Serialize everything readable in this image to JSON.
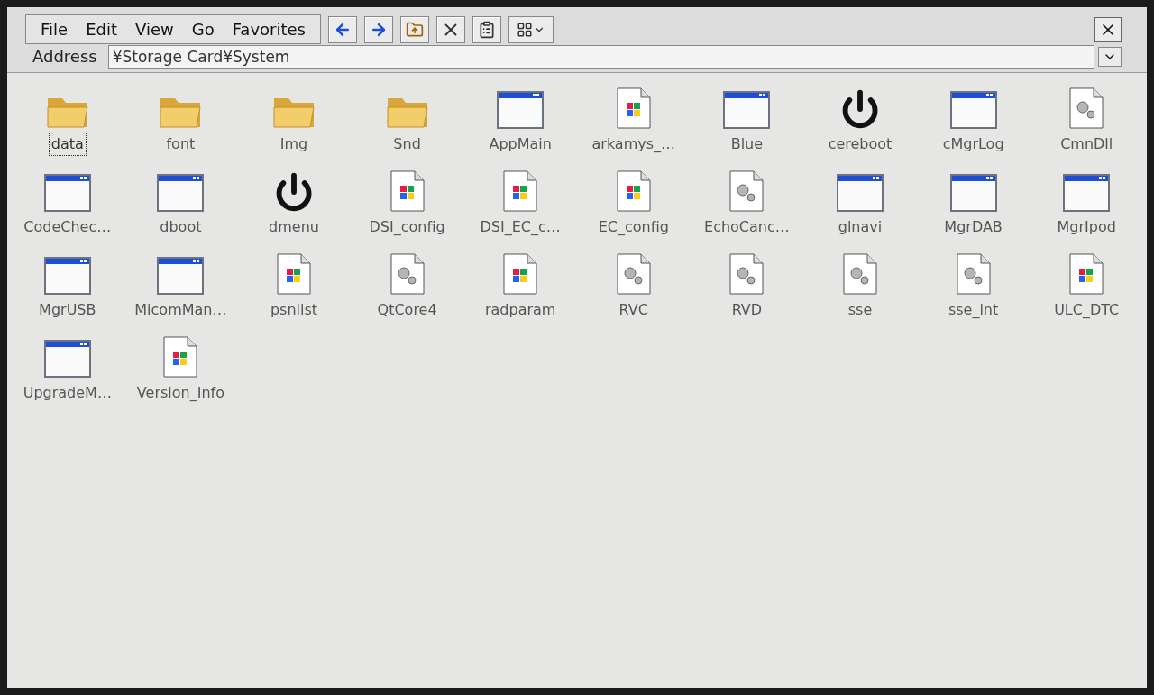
{
  "menu": [
    "File",
    "Edit",
    "View",
    "Go",
    "Favorites"
  ],
  "address": {
    "label": "Address",
    "value": "¥Storage Card¥System"
  },
  "files": [
    {
      "name": "data",
      "kind": "folder",
      "selected": true
    },
    {
      "name": "font",
      "kind": "folder",
      "selected": false
    },
    {
      "name": "Img",
      "kind": "folder",
      "selected": false
    },
    {
      "name": "Snd",
      "kind": "folder",
      "selected": false
    },
    {
      "name": "AppMain",
      "kind": "window",
      "selected": false
    },
    {
      "name": "arkamys_…",
      "kind": "document",
      "selected": false
    },
    {
      "name": "Blue",
      "kind": "window",
      "selected": false
    },
    {
      "name": "cereboot",
      "kind": "power",
      "selected": false
    },
    {
      "name": "cMgrLog",
      "kind": "window",
      "selected": false
    },
    {
      "name": "CmnDll",
      "kind": "settings",
      "selected": false
    },
    {
      "name": "CodeChec…",
      "kind": "window",
      "selected": false
    },
    {
      "name": "dboot",
      "kind": "window",
      "selected": false
    },
    {
      "name": "dmenu",
      "kind": "power",
      "selected": false
    },
    {
      "name": "DSI_config",
      "kind": "document",
      "selected": false
    },
    {
      "name": "DSI_EC_c…",
      "kind": "document",
      "selected": false
    },
    {
      "name": "EC_config",
      "kind": "document",
      "selected": false
    },
    {
      "name": "EchoCanc…",
      "kind": "settings",
      "selected": false
    },
    {
      "name": "glnavi",
      "kind": "window",
      "selected": false
    },
    {
      "name": "MgrDAB",
      "kind": "window",
      "selected": false
    },
    {
      "name": "MgrIpod",
      "kind": "window",
      "selected": false
    },
    {
      "name": "MgrUSB",
      "kind": "window",
      "selected": false
    },
    {
      "name": "MicomMan…",
      "kind": "window",
      "selected": false
    },
    {
      "name": "psnlist",
      "kind": "document",
      "selected": false
    },
    {
      "name": "QtCore4",
      "kind": "settings",
      "selected": false
    },
    {
      "name": "radparam",
      "kind": "document",
      "selected": false
    },
    {
      "name": "RVC",
      "kind": "settings",
      "selected": false
    },
    {
      "name": "RVD",
      "kind": "settings",
      "selected": false
    },
    {
      "name": "sse",
      "kind": "settings",
      "selected": false
    },
    {
      "name": "sse_int",
      "kind": "settings",
      "selected": false
    },
    {
      "name": "ULC_DTC",
      "kind": "document",
      "selected": false
    },
    {
      "name": "UpgradeM…",
      "kind": "window",
      "selected": false
    },
    {
      "name": "Version_Info",
      "kind": "document",
      "selected": false
    }
  ]
}
